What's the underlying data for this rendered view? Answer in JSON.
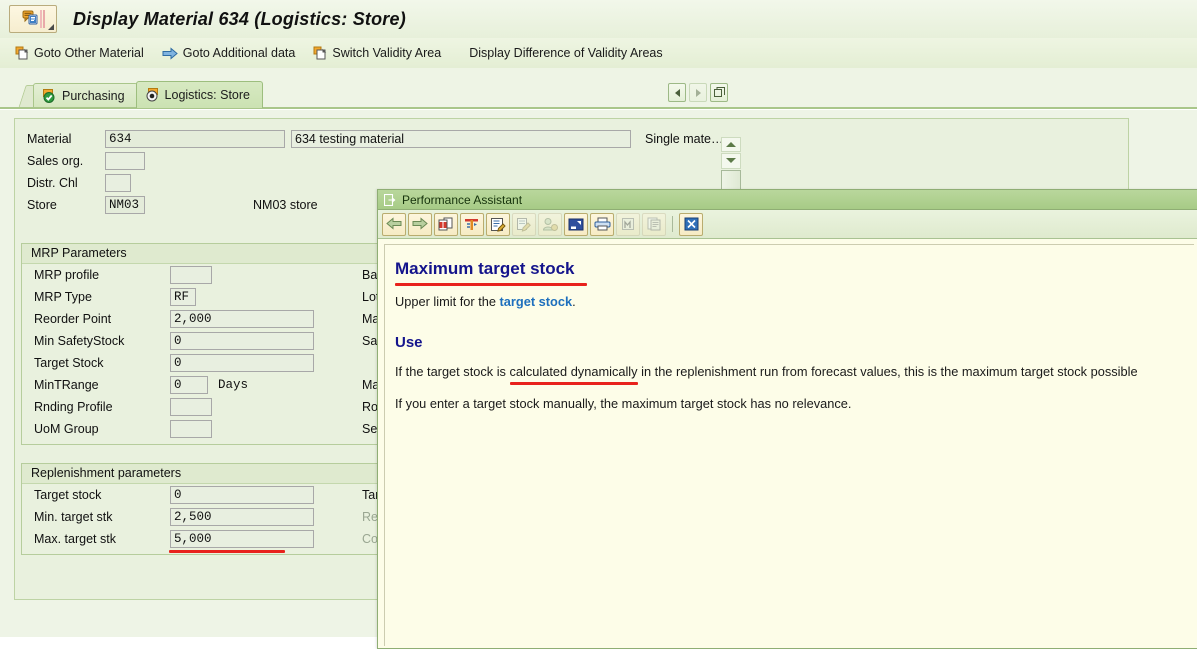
{
  "window": {
    "title": "Display Material 634 (Logistics: Store)",
    "icon": "sap-session-icon"
  },
  "function_toolbar": [
    {
      "label": "Goto Other Material",
      "icon": "document-new-icon"
    },
    {
      "label": "Goto Additional data",
      "icon": "arrow-right-icon"
    },
    {
      "label": "Switch Validity Area",
      "icon": "document-new-icon"
    },
    {
      "label": "Display Difference of Validity Areas",
      "icon": "none"
    }
  ],
  "tabs": [
    {
      "label": "Purchasing",
      "icon": "check-green-icon",
      "active": false
    },
    {
      "label": "Logistics: Store",
      "icon": "radio-selected-icon",
      "active": true
    }
  ],
  "tab_nav": {
    "prev_label": "◀",
    "next_label": "▶",
    "list_label": "❐"
  },
  "header_fields": [
    {
      "label": "Material",
      "value": "634",
      "desc": "634 testing material",
      "extra": "Single mate…"
    },
    {
      "label": "Sales org.",
      "value": "",
      "desc": "",
      "extra": ""
    },
    {
      "label": "Distr. Chl",
      "value": "",
      "desc": "",
      "extra": ""
    },
    {
      "label": "Store",
      "value": "NM03",
      "desc": "NM03 store",
      "extra": ""
    }
  ],
  "mrp_group": {
    "title": "MRP Parameters",
    "left_rows": [
      {
        "label": "MRP profile",
        "value": "",
        "width": "small",
        "unit": ""
      },
      {
        "label": "MRP Type",
        "value": "RF",
        "width": "tiny",
        "unit": ""
      },
      {
        "label": "Reorder Point",
        "value": "2,000",
        "width": "wide",
        "unit": ""
      },
      {
        "label": "Min SafetyStock",
        "value": "0",
        "width": "wide",
        "unit": ""
      },
      {
        "label": "Target Stock",
        "value": "0",
        "width": "wide",
        "unit": ""
      },
      {
        "label": "MinTRange",
        "value": "0",
        "width": "tiny2",
        "unit": "Days"
      },
      {
        "label": "Rnding Profile",
        "value": "",
        "width": "small",
        "unit": ""
      },
      {
        "label": "UoM Group",
        "value": "",
        "width": "small",
        "unit": ""
      }
    ],
    "right_labels": [
      "Base",
      "Lot S",
      "Max.S",
      "Safet",
      "",
      "MaxT",
      "Roun",
      "Servi"
    ]
  },
  "replenishment_group": {
    "title": "Replenishment parameters",
    "left_rows": [
      {
        "label": "Target stock",
        "value": "0",
        "dim": false
      },
      {
        "label": "Min. target stk",
        "value": "2,500",
        "dim": false
      },
      {
        "label": "Max. target stk",
        "value": "5,000",
        "dim": false
      }
    ],
    "right_labels": [
      {
        "label": "Targ",
        "dim": false
      },
      {
        "label": "Reple",
        "dim": true
      },
      {
        "label": "Corre",
        "dim": true
      }
    ]
  },
  "annotations": {
    "color": "#e8221c",
    "items": [
      "max-target-stk-underline",
      "help-title-underline",
      "calculated-dynamically-underline"
    ]
  },
  "dialog": {
    "title": "Performance Assistant",
    "title_icon": "help-window-icon",
    "toolbar": [
      {
        "name": "back-icon",
        "glyph": "←",
        "disabled": false
      },
      {
        "name": "forward-icon",
        "glyph": "→",
        "disabled": false
      },
      {
        "name": "glossary-icon",
        "glyph": "📖",
        "disabled": false
      },
      {
        "name": "technical-info-icon",
        "glyph": "🔧",
        "disabled": false
      },
      {
        "name": "note-create-icon",
        "glyph": "✎",
        "disabled": false
      },
      {
        "name": "note-edit-icon",
        "glyph": "✏",
        "disabled": true
      },
      {
        "name": "user-settings-icon",
        "glyph": "👤",
        "disabled": true
      },
      {
        "name": "display-note-icon",
        "glyph": "◰",
        "disabled": false
      },
      {
        "name": "print-icon",
        "glyph": "🖨",
        "disabled": false
      },
      {
        "name": "find-icon",
        "glyph": "🔍",
        "disabled": true
      },
      {
        "name": "copy-icon",
        "glyph": "❐",
        "disabled": true
      },
      {
        "name": "close-icon",
        "glyph": "✕",
        "disabled": false
      }
    ],
    "help": {
      "heading": "Maximum target stock",
      "intro_prefix": "Upper limit for the ",
      "intro_link": "target stock",
      "intro_suffix": ".",
      "use_heading": "Use",
      "para1_a": "If the target stock is ",
      "para1_b": "calculated dynamically",
      "para1_c": " in the replenishment run from forecast values, this is the maximum target stock possible",
      "para2": "If you enter a target stock manually, the maximum target stock has no relevance."
    }
  },
  "colors": {
    "app_background": "#eef4e6",
    "panel": "#e9f1de",
    "group_header": "#dfeacf",
    "dialog_background": "#fdfde8",
    "dialog_title": "#a7cb86",
    "help_heading": "#14148c",
    "help_link": "#1d6fbd",
    "annotation_red": "#e8221c",
    "tab_active": "#cbe2b2"
  }
}
